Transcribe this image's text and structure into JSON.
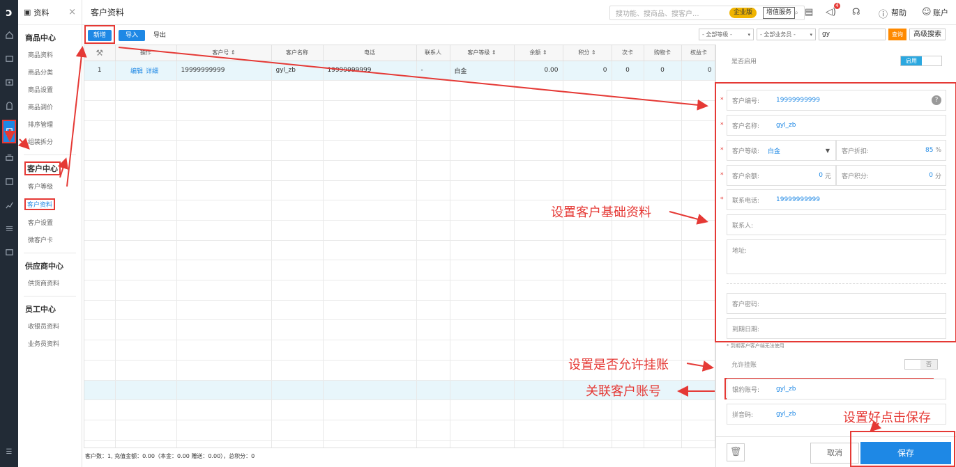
{
  "rail": {
    "logo": "ɔ",
    "icons": [
      "home-icon",
      "route-icon",
      "cash-icon",
      "shop-icon",
      "customer-icon",
      "wallet-icon",
      "box-icon",
      "chart-icon",
      "sliders-icon",
      "card-icon"
    ]
  },
  "menu": {
    "header": "资料",
    "close": "×",
    "product_center": "商品中心",
    "product_items": [
      "商品资料",
      "商品分类",
      "商品设置",
      "商品调价",
      "排序管理",
      "组装拆分"
    ],
    "customer_center": "客户中心",
    "customer_items": [
      "客户等级",
      "客户资料",
      "客户设置",
      "微客户卡"
    ],
    "supplier_center": "供应商中心",
    "supplier_items": [
      "供货商资料"
    ],
    "staff_center": "员工中心",
    "staff_items": [
      "收银员资料",
      "业务员资料"
    ]
  },
  "topbar": {
    "title": "客户资料",
    "search_placeholder": "搜功能、搜商品、搜客户...",
    "enterprise": "企业版",
    "value_added": "增值服务",
    "badge": "4",
    "help": "帮助",
    "account": "账户"
  },
  "toolbar": {
    "new": "新增",
    "import": "导入",
    "export": "导出"
  },
  "filters": {
    "level": "- 全部等级 -",
    "salesman": "- 全部业务员 -",
    "keyword": "gy",
    "query": "查询",
    "advanced": "高级搜索"
  },
  "table": {
    "headers": [
      "",
      "操作",
      "客户号 ⇕",
      "客户名称",
      "电话",
      "联系人",
      "客户等级 ⇕",
      "余额 ⇕",
      "积分 ⇕",
      "次卡",
      "购物卡",
      "权益卡"
    ],
    "rows": [
      {
        "idx": "1",
        "edit": "编辑",
        "detail": "详细",
        "code": "19999999999",
        "name": "gyl_zb",
        "phone": "19999999999",
        "contact": "-",
        "level": "白金",
        "balance": "0.00",
        "points": "0",
        "times": "0",
        "shop": "0",
        "right": "0"
      }
    ]
  },
  "footer": "客户数：1, 充值金额：0.00（本金：0.00 赠送：0.00），总积分：0",
  "panel": {
    "enabled_label": "是否启用",
    "enabled_on": "启用",
    "code_label": "客户编号:",
    "code_value": "19999999999",
    "name_label": "客户名称:",
    "name_value": "gyl_zb",
    "level_label": "客户等级:",
    "level_value": "白金",
    "discount_label": "客户折扣:",
    "discount_value": "85",
    "discount_unit": "%",
    "balance_label": "客户余额:",
    "balance_value": "0",
    "balance_unit": "元",
    "points_label": "客户积分:",
    "points_value": "0",
    "points_unit": "分",
    "phone_label": "联系电话:",
    "phone_value": "19999999999",
    "contact_label": "联系人:",
    "address_label": "地址:",
    "password_label": "客户密码:",
    "expire_label": "到期日期:",
    "expire_note": "* 到期客户客户端无法使用",
    "credit_label": "允许挂账",
    "credit_off": "否",
    "bind_label": "银豹账号:",
    "bind_value": "gyl_zb",
    "pinyin_label": "拼音码:",
    "pinyin_value": "gyl_zb",
    "cancel": "取消",
    "save": "保存"
  },
  "annotations": {
    "basic": "设置客户基础资料",
    "credit": "设置是否允许挂账",
    "bind": "关联客户账号",
    "save": "设置好点击保存"
  }
}
